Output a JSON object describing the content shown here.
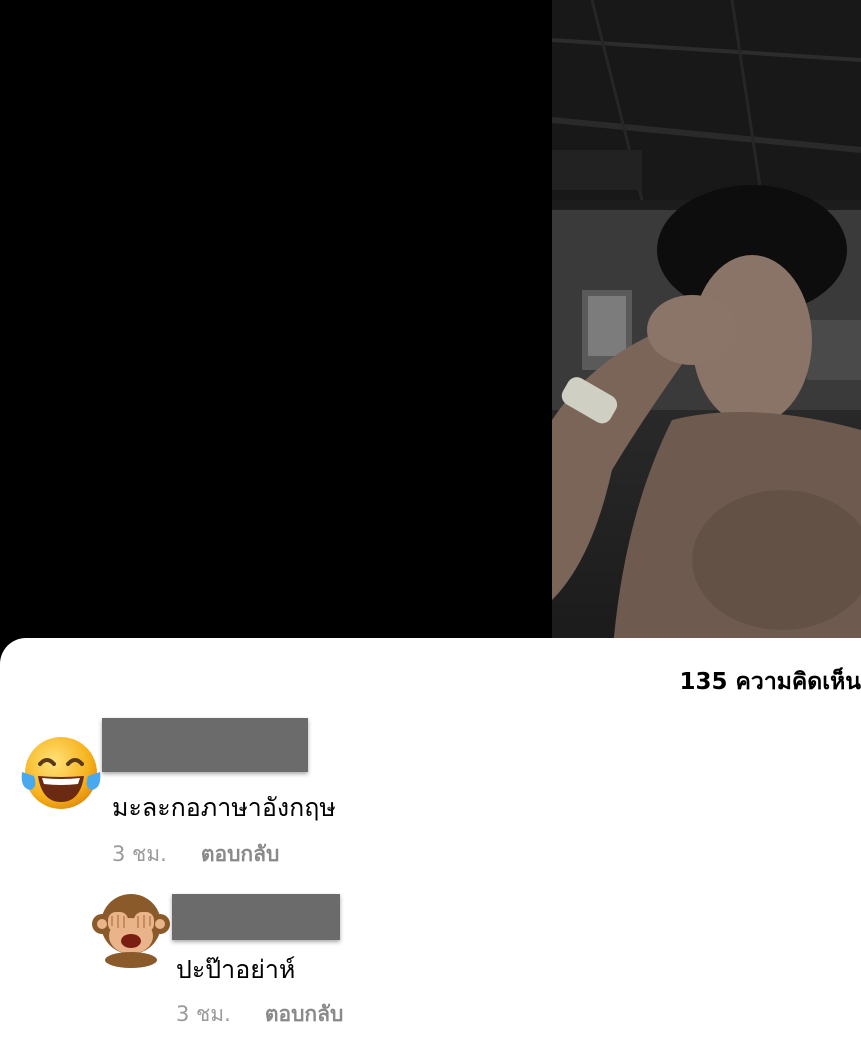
{
  "post": {
    "comment_count_label": "135 ความคิดเห็น"
  },
  "comments": [
    {
      "avatar_icon": "face-with-tears-of-joy-icon",
      "text": "มะละกอภาษาอังกฤษ",
      "time": "3 ชม.",
      "reply_label": "ตอบกลับ"
    },
    {
      "avatar_icon": "see-no-evil-monkey-icon",
      "text": "ปะป๊าอย่าห์",
      "time": "3 ชม.",
      "reply_label": "ตอบกลับ"
    }
  ]
}
